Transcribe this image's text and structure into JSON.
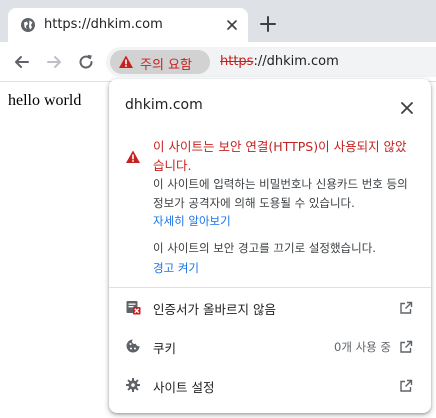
{
  "tab": {
    "title": "https://dhkim.com",
    "favicon": "globe-icon"
  },
  "toolbar": {
    "security_chip_label": "주의 요함",
    "url_scheme": "https",
    "url_rest": "://dhkim.com"
  },
  "page": {
    "body_text": "hello world"
  },
  "popup": {
    "host": "dhkim.com",
    "warning_title": "이 사이트는 보안 연결(HTTPS)이 사용되지 않았습니다.",
    "warning_desc": "이 사이트에 입력하는 비밀번호나 신용카드 번호 등의 정보가 공격자에 의해 도용될 수 있습니다.",
    "learn_more": "자세히 알아보기",
    "warnings_off_text": "이 사이트의 보안 경고를 끄기로 설정했습니다.",
    "turn_on": "경고 켜기",
    "rows": [
      {
        "label": "인증서가 올바르지 않음",
        "value": ""
      },
      {
        "label": "쿠키",
        "value": "0개 사용 중"
      },
      {
        "label": "사이트 설정",
        "value": ""
      }
    ]
  },
  "colors": {
    "danger": "#c5221f",
    "link": "#1a73e8",
    "tabstrip": "#dee1e6",
    "chip_bg": "#d2d2d2"
  }
}
